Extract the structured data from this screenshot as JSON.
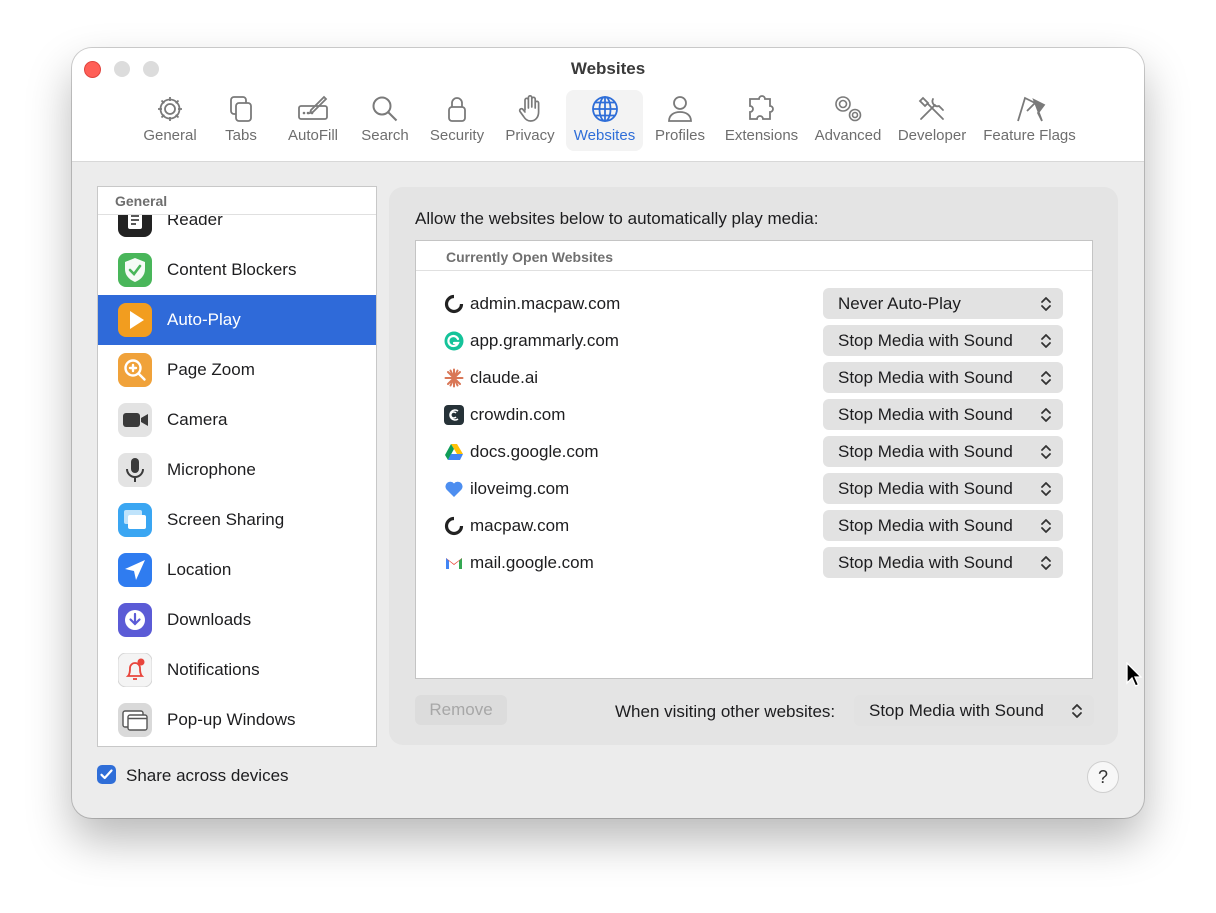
{
  "window": {
    "title": "Websites"
  },
  "toolbar": {
    "tabs": [
      {
        "label": "General",
        "icon": "gear-icon"
      },
      {
        "label": "Tabs",
        "icon": "tabs-icon"
      },
      {
        "label": "AutoFill",
        "icon": "pencil-field-icon"
      },
      {
        "label": "Search",
        "icon": "search-icon"
      },
      {
        "label": "Security",
        "icon": "lock-icon"
      },
      {
        "label": "Privacy",
        "icon": "hand-icon"
      },
      {
        "label": "Websites",
        "icon": "globe-icon",
        "selected": true
      },
      {
        "label": "Profiles",
        "icon": "person-icon"
      },
      {
        "label": "Extensions",
        "icon": "puzzle-icon"
      },
      {
        "label": "Advanced",
        "icon": "gears-icon"
      },
      {
        "label": "Developer",
        "icon": "tools-icon"
      },
      {
        "label": "Feature Flags",
        "icon": "flags-icon"
      }
    ]
  },
  "sidebar": {
    "header": "General",
    "items": [
      {
        "label": "Reader",
        "icon": "reader-icon"
      },
      {
        "label": "Content Blockers",
        "icon": "shield-check-icon"
      },
      {
        "label": "Auto-Play",
        "icon": "play-icon",
        "selected": true
      },
      {
        "label": "Page Zoom",
        "icon": "zoom-icon"
      },
      {
        "label": "Camera",
        "icon": "camera-icon"
      },
      {
        "label": "Microphone",
        "icon": "microphone-icon"
      },
      {
        "label": "Screen Sharing",
        "icon": "screen-sharing-icon"
      },
      {
        "label": "Location",
        "icon": "location-arrow-icon"
      },
      {
        "label": "Downloads",
        "icon": "download-icon"
      },
      {
        "label": "Notifications",
        "icon": "bell-icon"
      },
      {
        "label": "Pop-up Windows",
        "icon": "popup-window-icon"
      }
    ]
  },
  "share": {
    "label": "Share across devices",
    "checked": true
  },
  "help": {
    "label": "?"
  },
  "main": {
    "title": "Allow the websites below to automatically play media:",
    "list_header": "Currently Open Websites",
    "sites": [
      {
        "domain": "admin.macpaw.com",
        "setting": "Never Auto-Play",
        "icon": "macpaw-icon"
      },
      {
        "domain": "app.grammarly.com",
        "setting": "Stop Media with Sound",
        "icon": "grammarly-icon"
      },
      {
        "domain": "claude.ai",
        "setting": "Stop Media with Sound",
        "icon": "claude-icon"
      },
      {
        "domain": "crowdin.com",
        "setting": "Stop Media with Sound",
        "icon": "crowdin-icon"
      },
      {
        "domain": "docs.google.com",
        "setting": "Stop Media with Sound",
        "icon": "google-drive-icon"
      },
      {
        "domain": "iloveimg.com",
        "setting": "Stop Media with Sound",
        "icon": "iloveimg-icon"
      },
      {
        "domain": "macpaw.com",
        "setting": "Stop Media with Sound",
        "icon": "macpaw-icon"
      },
      {
        "domain": "mail.google.com",
        "setting": "Stop Media with Sound",
        "icon": "gmail-icon"
      }
    ],
    "remove_label": "Remove",
    "other_label": "When visiting other websites:",
    "other_setting": "Stop Media with Sound"
  },
  "colors": {
    "accent": "#2f6ed8",
    "selection": "#2f6ad9",
    "close": "#ff5f57"
  }
}
